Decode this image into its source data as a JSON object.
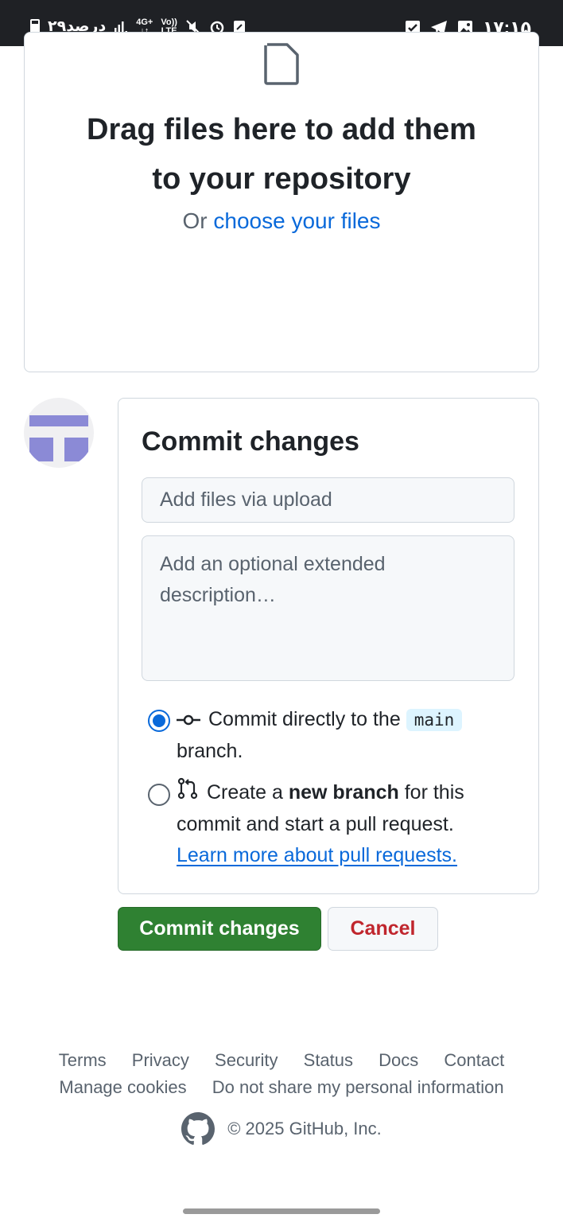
{
  "status_bar": {
    "left_text": "۲۹درصد",
    "network_top": "4G+",
    "volte_top": "Vo))",
    "volte_bottom": "LTE",
    "time": "۱۷:۱۵"
  },
  "dropzone": {
    "title_line1": "Drag files here to add them",
    "title_line2": "to your repository",
    "or_text": "Or",
    "choose_link": "choose your files"
  },
  "commit": {
    "heading": "Commit changes",
    "summary_placeholder": "Add files via upload",
    "description_placeholder": "Add an optional extended description…",
    "option_direct": {
      "prefix": "Commit directly to the",
      "branch": "main",
      "suffix": "branch.",
      "selected": true
    },
    "option_new_branch": {
      "prefix": "Create a",
      "bold": "new branch",
      "suffix": "for this commit and start a pull request.",
      "link": "Learn more about pull requests.",
      "selected": false
    }
  },
  "buttons": {
    "commit_label": "Commit changes",
    "cancel_label": "Cancel"
  },
  "footer": {
    "links": [
      "Terms",
      "Privacy",
      "Security",
      "Status",
      "Docs",
      "Contact"
    ],
    "links_row2": [
      "Manage cookies",
      "Do not share my personal information"
    ],
    "copyright": "© 2025 GitHub, Inc."
  },
  "colors": {
    "accent_link": "#0969da",
    "commit_button": "#2f8132",
    "cancel_text": "#c0262d",
    "avatar_shape": "#8b8ad6"
  },
  "icons": {
    "file": "file-icon",
    "commit": "git-commit-icon",
    "pull_request": "git-pull-request-icon",
    "github": "github-mark-icon"
  }
}
